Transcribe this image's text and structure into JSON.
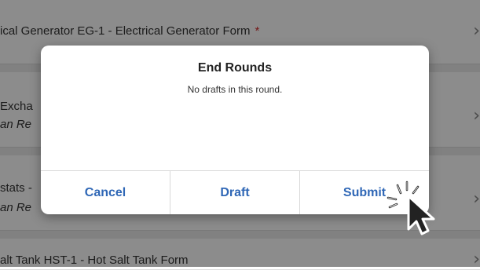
{
  "background": {
    "rows": [
      {
        "title": "ical Generator EG-1 - Electrical Generator Form",
        "required_mark": "*"
      },
      {
        "title": "Excha",
        "subtitle": "an Re"
      },
      {
        "title": "stats -",
        "subtitle": "an Re"
      },
      {
        "title": "alt Tank HST-1 - Hot Salt Tank Form"
      }
    ],
    "chevron": "›"
  },
  "dialog": {
    "title": "End Rounds",
    "message": "No drafts in this round.",
    "buttons": {
      "cancel": "Cancel",
      "draft": "Draft",
      "submit": "Submit"
    }
  },
  "colors": {
    "button_text": "#2f67b6",
    "required_star": "#d32f2f",
    "overlay": "rgba(0,0,0,0.45)"
  },
  "icons": {
    "cursor": "pointer-cursor-icon",
    "click_burst": "click-burst-icon"
  }
}
